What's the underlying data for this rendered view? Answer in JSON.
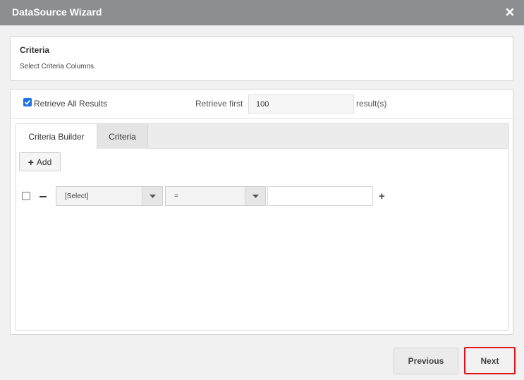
{
  "window": {
    "title": "DataSource Wizard",
    "close_icon": "close-icon",
    "colors": {
      "titlebar": "#8d8e92",
      "highlight": "#e0141a",
      "checkbox": "#1a73e8"
    }
  },
  "header": {
    "title": "Criteria",
    "description": "Select Criteria Columns."
  },
  "retrieve": {
    "all_label": "Retrieve All Results",
    "all_checked": true,
    "first_label": "Retrieve first",
    "first_value": "100",
    "results_label": "result(s)"
  },
  "tabs": [
    {
      "label": "Criteria Builder",
      "active": true
    },
    {
      "label": "Criteria",
      "active": false
    }
  ],
  "builder": {
    "add_label": "Add",
    "rows": [
      {
        "field": "[Select]",
        "operator": "=",
        "value": ""
      }
    ]
  },
  "footer": {
    "previous_label": "Previous",
    "next_label": "Next"
  }
}
